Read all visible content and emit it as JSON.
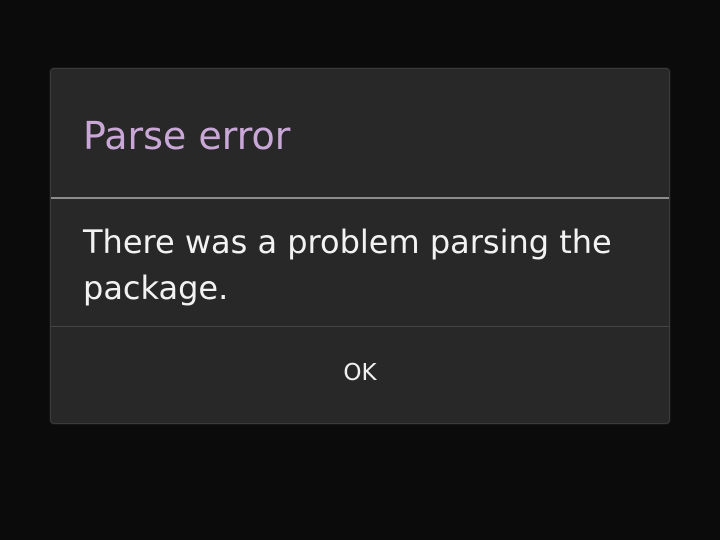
{
  "dialog": {
    "title": "Parse error",
    "message": "There was a problem parsing the package.",
    "ok_label": "OK"
  },
  "colors": {
    "background": "#0b0b0b",
    "dialog_background": "#282828",
    "title_color": "#c9a8d8",
    "text_color": "#f2f2f2",
    "divider_color": "#8c8c8c"
  }
}
